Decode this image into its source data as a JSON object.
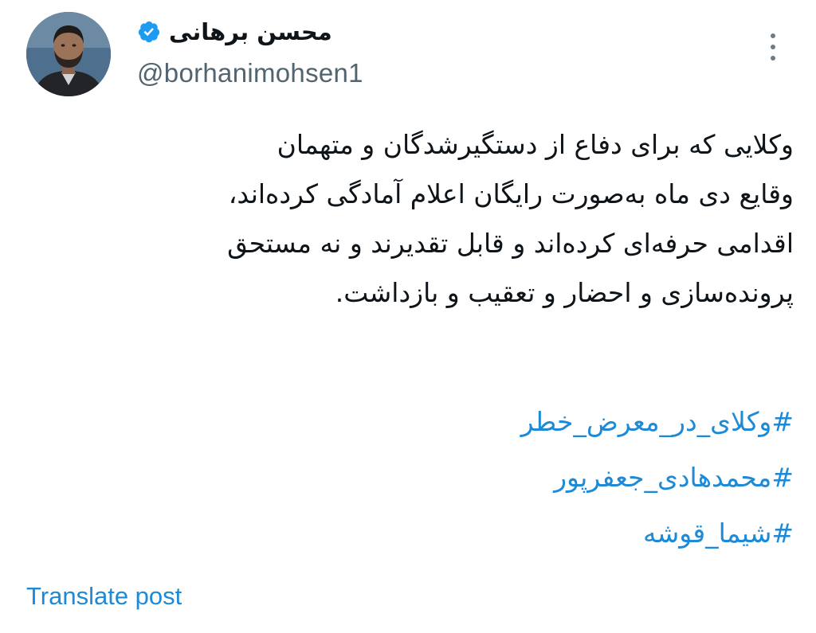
{
  "author": {
    "display_name": "محسن برهانی",
    "handle": "@borhanimohsen1",
    "verified_icon": "verified-badge-icon",
    "avatar_icon": "avatar"
  },
  "menu": {
    "icon": "more-vertical-icon"
  },
  "tweet": {
    "lines": [
      "وکلایی که برای دفاع از دستگیرشدگان و متهمان",
      "وقایع دی ماه به‌صورت رایگان اعلام آمادگی کرده‌اند،",
      "اقدامی حرفه‌ای کرده‌اند و قابل تقدیرند و نه مستحق",
      "پرونده‌سازی و احضار و تعقیب و بازداشت."
    ],
    "hashtags": [
      "#وکلای_در_معرض_خطر",
      "#محمدهادی_جعفرپور",
      "#شیما_قوشه"
    ]
  },
  "actions": {
    "translate_label": "Translate post"
  },
  "colors": {
    "link": "#1d8ad8",
    "secondary_text": "#536471",
    "verified": "#1d9bf0"
  }
}
